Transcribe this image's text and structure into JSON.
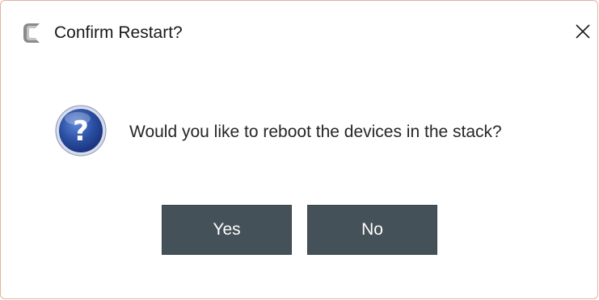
{
  "dialog": {
    "title": "Confirm Restart?",
    "message": "Would you like to reboot the devices in the stack?",
    "app_icon": "c-logo-icon",
    "message_icon": "question-icon",
    "close_icon": "close-icon"
  },
  "buttons": {
    "yes_label": "Yes",
    "no_label": "No"
  },
  "colors": {
    "button_bg": "#445159",
    "border_accent": "#e3b39b",
    "question_blue": "#2a4fa0"
  }
}
